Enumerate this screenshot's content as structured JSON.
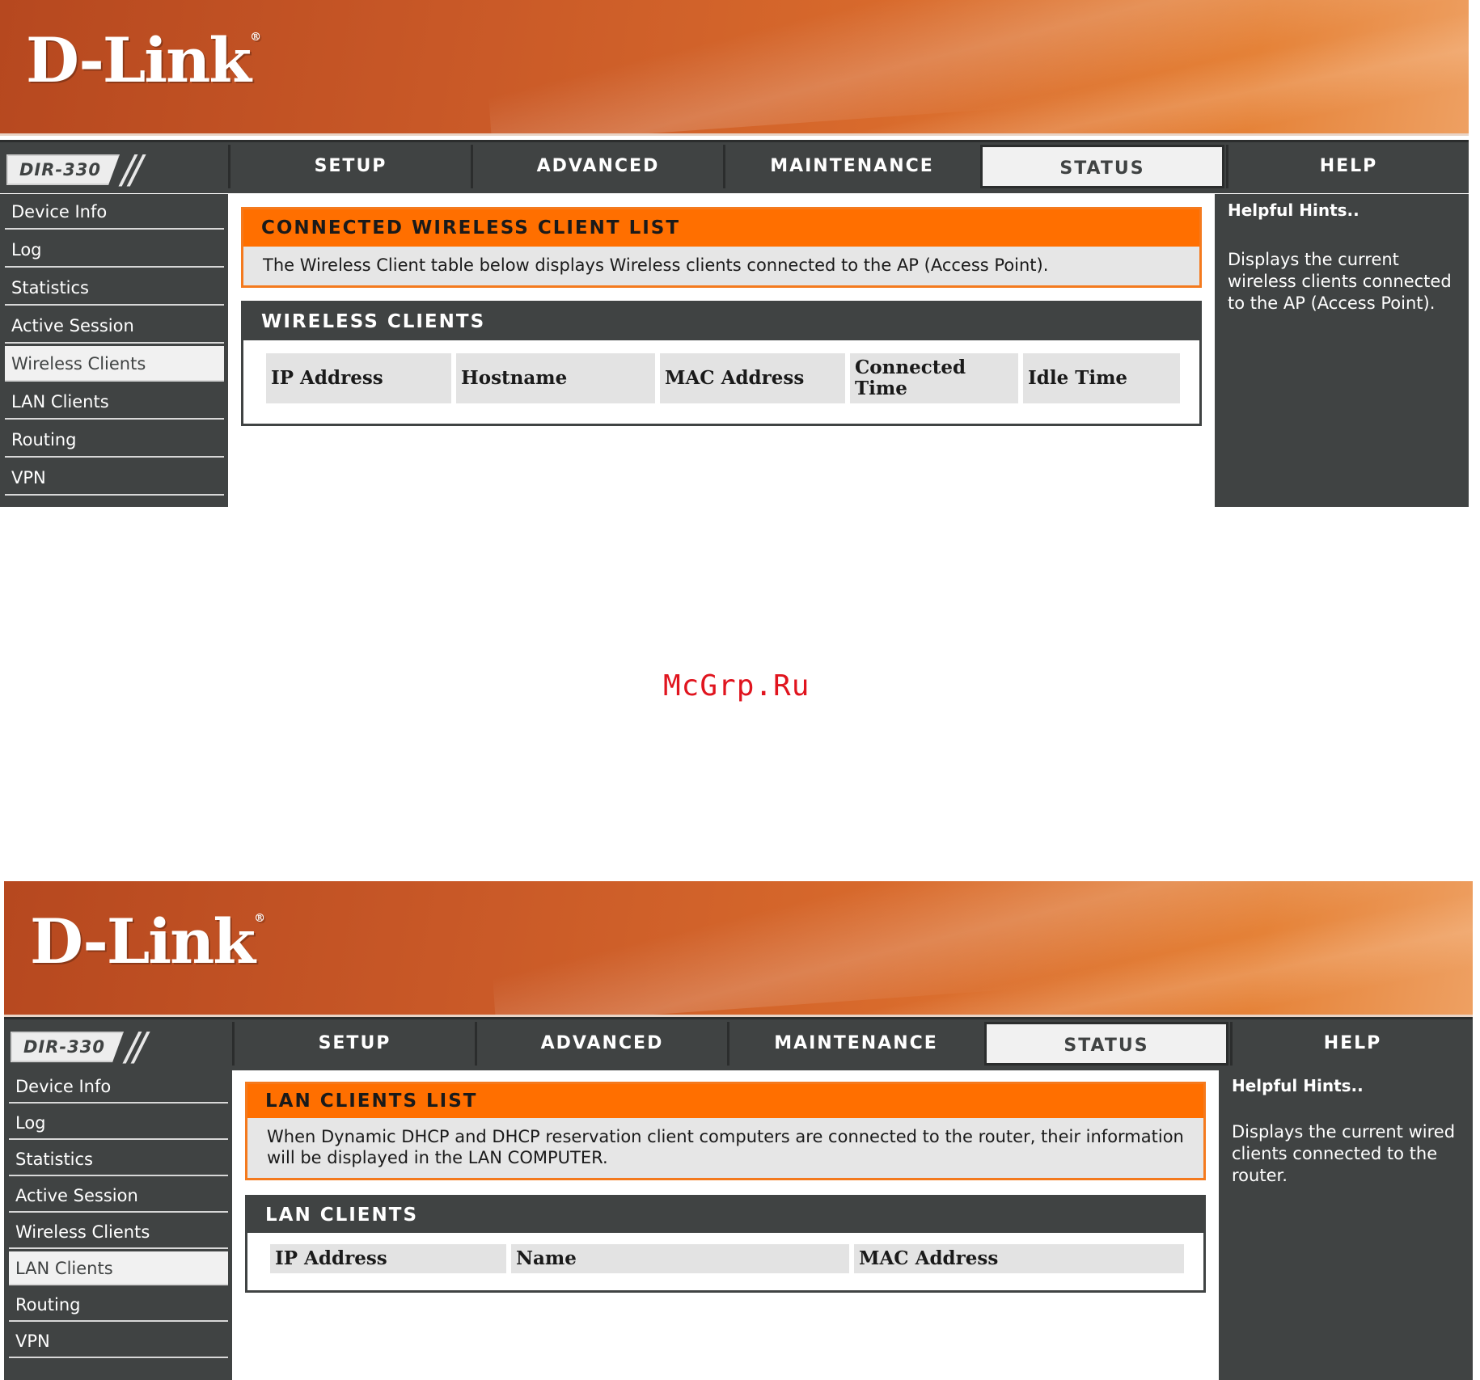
{
  "brand": {
    "logo": "D-Link",
    "model": "DIR-330"
  },
  "nav_tabs": [
    "SETUP",
    "ADVANCED",
    "MAINTENANCE",
    "STATUS",
    "HELP"
  ],
  "sidebar_items": [
    "Device Info",
    "Log",
    "Statistics",
    "Active Session",
    "Wireless Clients",
    "LAN Clients",
    "Routing",
    "VPN"
  ],
  "watermark": "McGrp.Ru",
  "screen1": {
    "active_tab": "STATUS",
    "active_sidebar": "Wireless Clients",
    "panel_title": "CONNECTED WIRELESS CLIENT LIST",
    "panel_text": "The Wireless Client table below displays Wireless clients connected to the AP (Access Point).",
    "box_title": "WIRELESS CLIENTS",
    "columns": [
      "IP Address",
      "Hostname",
      "MAC Address",
      "Connected Time",
      "Idle Time"
    ],
    "hints_title": "Helpful Hints..",
    "hints_text": "Displays the current wireless clients connected to the AP (Access Point)."
  },
  "screen2": {
    "active_tab": "STATUS",
    "active_sidebar": "LAN Clients",
    "panel_title": "LAN CLIENTS LIST",
    "panel_text": "When Dynamic DHCP and DHCP reservation client computers are connected to the router, their information will be displayed in the LAN COMPUTER.",
    "box_title": "LAN CLIENTS",
    "columns": [
      "IP Address",
      "Name",
      "MAC Address"
    ],
    "hints_title": "Helpful Hints..",
    "hints_text": "Displays the current wired clients connected to the router."
  },
  "colors": {
    "accent": "#ff6f00",
    "dark": "#404343",
    "panel_bg": "#e6e6e6"
  }
}
